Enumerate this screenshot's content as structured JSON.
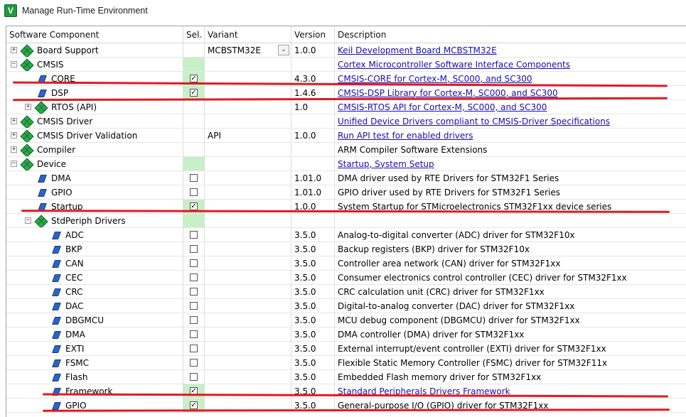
{
  "window": {
    "title": "Manage Run-Time Environment"
  },
  "columns": {
    "component": "Software Component",
    "sel": "Sel.",
    "variant": "Variant",
    "version": "Version",
    "description": "Description"
  },
  "rows": [
    {
      "name": "Board Support",
      "level": 0,
      "icon": "gem-icon",
      "expander": "+",
      "selected": "",
      "variant": "MCBSTM32E",
      "variant_dropdown": "true",
      "version": "1.0.0",
      "description": "Keil Development Board MCBSTM32E",
      "link": true
    },
    {
      "name": "CMSIS",
      "level": 0,
      "icon": "gem-icon",
      "expander": "−",
      "selected": "green",
      "variant": "",
      "version": "",
      "description": "Cortex Microcontroller Software Interface Components",
      "link": true
    },
    {
      "name": "CORE",
      "level": 1,
      "icon": "leaf-icon",
      "expander": "",
      "selected": "checked",
      "variant": "",
      "version": "4.3.0",
      "description": "CMSIS-CORE for Cortex-M, SC000, and SC300",
      "link": true
    },
    {
      "name": "DSP",
      "level": 1,
      "icon": "leaf-icon",
      "expander": "",
      "selected": "checked",
      "variant": "",
      "version": "1.4.6",
      "description": "CMSIS-DSP Library for Cortex-M, SC000, and SC300",
      "link": true
    },
    {
      "name": "RTOS (API)",
      "level": 1,
      "icon": "gem-icon",
      "expander": "+",
      "selected": "",
      "variant": "",
      "version": "1.0",
      "description": "CMSIS-RTOS API for Cortex-M, SC000, and SC300",
      "link": true
    },
    {
      "name": "CMSIS Driver",
      "level": 0,
      "icon": "gem-icon",
      "expander": "+",
      "selected": "",
      "variant": "",
      "version": "",
      "description": "Unified Device Drivers compliant to CMSIS-Driver Specifications",
      "link": true
    },
    {
      "name": "CMSIS Driver Validation",
      "level": 0,
      "icon": "gem-icon",
      "expander": "+",
      "selected": "",
      "variant": "API",
      "version": "1.0.0",
      "description": "Run API test for enabled drivers",
      "link": true
    },
    {
      "name": "Compiler",
      "level": 0,
      "icon": "gem-icon",
      "expander": "+",
      "selected": "",
      "variant": "",
      "version": "",
      "description": "ARM Compiler Software Extensions",
      "link": false
    },
    {
      "name": "Device",
      "level": 0,
      "icon": "gem-icon",
      "expander": "−",
      "selected": "green",
      "variant": "",
      "version": "",
      "description": "Startup, System Setup",
      "link": true
    },
    {
      "name": "DMA",
      "level": 1,
      "icon": "leaf-icon",
      "expander": "",
      "selected": "unchecked",
      "variant": "",
      "version": "1.01.0",
      "description": "DMA driver used by RTE Drivers for STM32F1 Series",
      "link": false
    },
    {
      "name": "GPIO",
      "level": 1,
      "icon": "leaf-icon",
      "expander": "",
      "selected": "unchecked",
      "variant": "",
      "version": "1.01.0",
      "description": "GPIO driver used by RTE Drivers for STM32F1 Series",
      "link": false
    },
    {
      "name": "Startup",
      "level": 1,
      "icon": "leaf-icon",
      "expander": "",
      "selected": "checked",
      "variant": "",
      "version": "1.0.0",
      "description": "System Startup for STMicroelectronics STM32F1xx device series",
      "link": false
    },
    {
      "name": "StdPeriph Drivers",
      "level": 1,
      "icon": "gem-icon",
      "expander": "−",
      "selected": "green",
      "variant": "",
      "version": "",
      "description": "",
      "link": false
    },
    {
      "name": "ADC",
      "level": 2,
      "icon": "leaf-icon",
      "expander": "",
      "selected": "unchecked",
      "variant": "",
      "version": "3.5.0",
      "description": "Analog-to-digital converter (ADC) driver for STM32F10x",
      "link": false
    },
    {
      "name": "BKP",
      "level": 2,
      "icon": "leaf-icon",
      "expander": "",
      "selected": "unchecked",
      "variant": "",
      "version": "3.5.0",
      "description": "Backup registers (BKP) driver for STM32F10x",
      "link": false
    },
    {
      "name": "CAN",
      "level": 2,
      "icon": "leaf-icon",
      "expander": "",
      "selected": "unchecked",
      "variant": "",
      "version": "3.5.0",
      "description": "Controller area network (CAN) driver for STM32F1xx",
      "link": false
    },
    {
      "name": "CEC",
      "level": 2,
      "icon": "leaf-icon",
      "expander": "",
      "selected": "unchecked",
      "variant": "",
      "version": "3.5.0",
      "description": "Consumer electronics control controller (CEC) driver for STM32F1xx",
      "link": false
    },
    {
      "name": "CRC",
      "level": 2,
      "icon": "leaf-icon",
      "expander": "",
      "selected": "unchecked",
      "variant": "",
      "version": "3.5.0",
      "description": "CRC calculation unit (CRC) driver for STM32F1xx",
      "link": false
    },
    {
      "name": "DAC",
      "level": 2,
      "icon": "leaf-icon",
      "expander": "",
      "selected": "unchecked",
      "variant": "",
      "version": "3.5.0",
      "description": "Digital-to-analog converter (DAC) driver for STM32F1xx",
      "link": false
    },
    {
      "name": "DBGMCU",
      "level": 2,
      "icon": "leaf-icon",
      "expander": "",
      "selected": "unchecked",
      "variant": "",
      "version": "3.5.0",
      "description": "MCU debug component (DBGMCU) driver for STM32F1xx",
      "link": false
    },
    {
      "name": "DMA",
      "level": 2,
      "icon": "leaf-icon",
      "expander": "",
      "selected": "unchecked",
      "variant": "",
      "version": "3.5.0",
      "description": "DMA controller (DMA) driver for STM32F1xx",
      "link": false
    },
    {
      "name": "EXTI",
      "level": 2,
      "icon": "leaf-icon",
      "expander": "",
      "selected": "unchecked",
      "variant": "",
      "version": "3.5.0",
      "description": "External interrupt/event controller (EXTI) driver for STM32F1xx",
      "link": false
    },
    {
      "name": "FSMC",
      "level": 2,
      "icon": "leaf-icon",
      "expander": "",
      "selected": "unchecked",
      "variant": "",
      "version": "3.5.0",
      "description": "Flexible Static Memory Controller (FSMC) driver for STM32F11x",
      "link": false
    },
    {
      "name": "Flash",
      "level": 2,
      "icon": "leaf-icon",
      "expander": "",
      "selected": "unchecked",
      "variant": "",
      "version": "3.5.0",
      "description": "Embedded Flash memory driver for STM32F1xx",
      "link": false
    },
    {
      "name": "Framework",
      "level": 2,
      "icon": "leaf-icon",
      "expander": "",
      "selected": "checked",
      "variant": "",
      "version": "3.5.0",
      "description": "Standard Peripherals Drivers Framework",
      "link": true
    },
    {
      "name": "GPIO",
      "level": 2,
      "icon": "leaf-icon",
      "expander": "",
      "selected": "checked",
      "variant": "",
      "version": "3.5.0",
      "description": "General-purpose I/O (GPIO) driver for STM32F1xx",
      "link": false
    }
  ],
  "colors": {
    "link": "#1a0dab",
    "selected_green": "#c7f0c7",
    "highlight_red": "#e01a22",
    "gem_green": "#2aa84a",
    "leaf_blue": "#2c64c8"
  }
}
